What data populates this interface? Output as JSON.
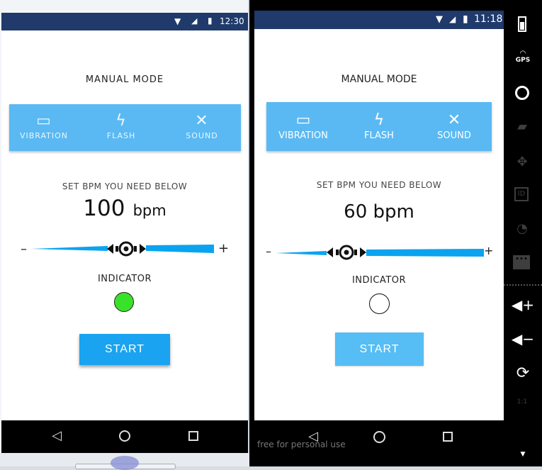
{
  "left_device": {
    "status_time": "12:30",
    "title": "MANUAL MODE",
    "tabs": [
      {
        "label": "VIBRATION",
        "icon": "vibration-icon"
      },
      {
        "label": "FLASH",
        "icon": "flash-icon"
      },
      {
        "label": "SOUND",
        "icon": "sound-muted-icon"
      }
    ],
    "set_bpm_label": "SET BPM YOU NEED BELOW",
    "bpm_value": "100",
    "bpm_unit": "bpm",
    "minus": "–",
    "plus": "+",
    "indicator_label": "INDICATOR",
    "indicator_color": "#39e22a",
    "start_label": "START"
  },
  "right_device": {
    "status_time": "11:18",
    "title": "MANUAL MODE",
    "tabs": [
      {
        "label": "VIBRATION",
        "icon": "vibration-icon"
      },
      {
        "label": "FLASH",
        "icon": "flash-icon"
      },
      {
        "label": "SOUND",
        "icon": "sound-muted-icon"
      }
    ],
    "set_bpm_label": "SET BPM YOU NEED BELOW",
    "bpm_text": "60 bpm",
    "minus": "–",
    "plus": "+",
    "indicator_label": "INDICATOR",
    "start_label": "START",
    "watermark": "free for personal use"
  },
  "emulator_sidebar": {
    "gps_label": "GPS",
    "id_label": "ID",
    "ratio_label": "1:1"
  },
  "colors": {
    "status_bar": "#1f3a6b",
    "tab_bar": "#5ab9f3",
    "slider_blue": "#0aa3f0",
    "start_left": "#1aa3f0",
    "start_right": "#56bdf5"
  }
}
